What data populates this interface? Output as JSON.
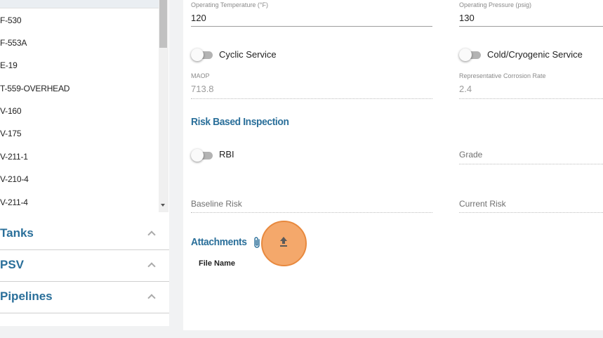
{
  "sidebar": {
    "equipment_items": [
      "F-530",
      "F-553A",
      "E-19",
      "T-559-OVERHEAD",
      "V-160",
      "V-175",
      "V-211-1",
      "V-210-4",
      "V-211-4"
    ],
    "sections": [
      {
        "label": "Tanks"
      },
      {
        "label": "PSV"
      },
      {
        "label": "Pipelines"
      }
    ]
  },
  "form": {
    "operating_temperature": {
      "label": "Operating Temperature (°F)",
      "value": "120"
    },
    "operating_pressure": {
      "label": "Operating Pressure (psig)",
      "value": "130"
    },
    "cyclic_service": {
      "label": "Cyclic Service",
      "on": false
    },
    "cold_cryogenic_service": {
      "label": "Cold/Cryogenic Service",
      "on": false
    },
    "maop": {
      "label": "MAOP",
      "value": "713.8"
    },
    "representative_corrosion_rate": {
      "label": "Representative Corrosion Rate",
      "value": "2.4"
    },
    "rbi_section_title": "Risk Based Inspection",
    "rbi": {
      "label": "RBI",
      "on": false
    },
    "grade": {
      "label": "Grade"
    },
    "baseline_risk": {
      "label": "Baseline Risk"
    },
    "current_risk": {
      "label": "Current Risk"
    }
  },
  "attachments": {
    "title": "Attachments",
    "columns": [
      "File Name"
    ]
  },
  "colors": {
    "accent": "#2a6f9a",
    "highlight": "#f4a86b"
  }
}
